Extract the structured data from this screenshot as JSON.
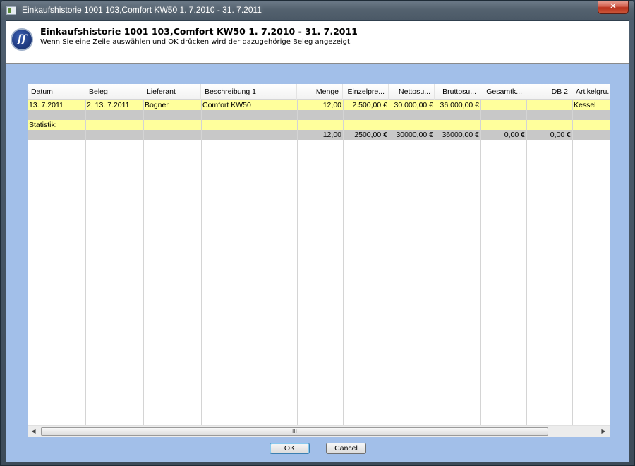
{
  "window": {
    "title": "Einkaufshistorie 1001 103,Comfort KW50   1.  7.2010 - 31.  7.2011",
    "close_label": "✕"
  },
  "header": {
    "logo_text": "ff",
    "title": "Einkaufshistorie 1001 103,Comfort KW50   1.  7.2010 - 31.  7.2011",
    "subtitle": "Wenn Sie eine Zeile auswählen und OK drücken wird der dazugehörige Beleg angezeigt."
  },
  "table": {
    "columns": [
      "Datum",
      "Beleg",
      "Lieferant",
      "Beschreibung 1",
      "Menge",
      "Einzelpre...",
      "Nettosu...",
      "Bruttosu...",
      "Gesamtk...",
      "DB 2",
      "Artikelgru..."
    ],
    "rows": [
      {
        "style": "yellow",
        "cells": [
          "13.  7.2011",
          "2, 13.  7.2011",
          "Bogner",
          "Comfort KW50",
          "12,00",
          "2.500,00 €",
          "30.000,00 €",
          "36.000,00 €",
          "",
          "",
          "Kessel"
        ]
      },
      {
        "style": "gray",
        "cells": [
          "",
          "",
          "",
          "",
          "",
          "",
          "",
          "",
          "",
          "",
          ""
        ]
      },
      {
        "style": "yellow",
        "cells": [
          "Statistik:",
          "",
          "",
          "",
          "",
          "",
          "",
          "",
          "",
          "",
          ""
        ]
      },
      {
        "style": "gray",
        "cells": [
          "",
          "",
          "",
          "",
          "12,00",
          "2500,00 €",
          "30000,00 €",
          "36000,00 €",
          "0,00 €",
          "0,00 €",
          ""
        ]
      }
    ],
    "scroll_grip": "III"
  },
  "buttons": {
    "ok": "OK",
    "cancel": "Cancel"
  },
  "colors": {
    "row_yellow": "#ffff9c",
    "row_gray": "#c8c8c8",
    "client_background": "#a2bfe9"
  }
}
